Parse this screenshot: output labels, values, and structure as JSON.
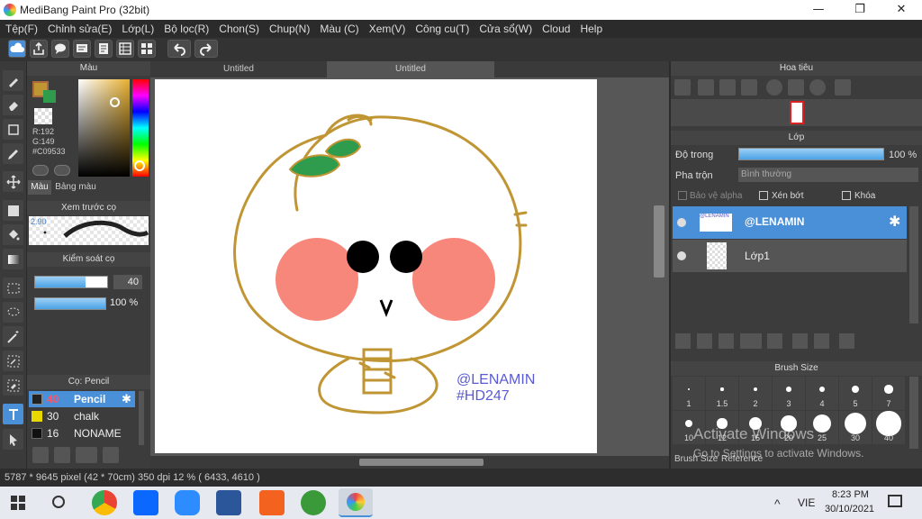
{
  "window": {
    "title": "MediBang Paint Pro (32bit)",
    "minimize": "—",
    "maximize": "❐",
    "close": "✕"
  },
  "menu": [
    "Tệp(F)",
    "Chỉnh sửa(E)",
    "Lớp(L)",
    "Bộ lọc(R)",
    "Chon(S)",
    "Chup(N)",
    "Màu (C)",
    "Xem(V)",
    "Công cu(T)",
    "Cửa sổ(W)",
    "Cloud",
    "Help"
  ],
  "toolbar_icons": [
    "cloud-icon",
    "share-icon",
    "comment-icon",
    "message-icon",
    "document-icon",
    "grid-icon",
    "layout-icon",
    "undo-icon",
    "redo-icon"
  ],
  "left_tools": [
    "brush-icon",
    "eraser-icon",
    "rectangle-icon",
    "pen-icon",
    "move-icon",
    "fill-rect-icon",
    "bucket-icon",
    "gradient-icon",
    "select-rect-icon",
    "lasso-icon",
    "magic-wand-icon",
    "select-pen-icon",
    "select-eraser-icon",
    "text-icon",
    "operation-icon"
  ],
  "color_panel": {
    "title": "Màu",
    "r": "R:192",
    "g": "G:149",
    "hex": "#C09533",
    "primary": "#C09533",
    "secondary": "#2e9c4c",
    "tab_color": "Màu",
    "tab_palette": "Bảng màu"
  },
  "brush_preview": {
    "title": "Xem trước cọ",
    "size": "2.90"
  },
  "brush_control": {
    "title": "Kiểm soát cọ",
    "size_value": "40",
    "opacity_value": "100 %",
    "size_fraction": 0.7,
    "opacity_fraction": 1.0
  },
  "brush_list": {
    "title": "Cọ: Pencil",
    "items": [
      {
        "size": "40",
        "name": "Pencil",
        "color": "#222222",
        "selected": true
      },
      {
        "size": "30",
        "name": "chalk",
        "color": "#e8d800",
        "selected": false
      },
      {
        "size": "16",
        "name": "NONAME",
        "color": "#111111",
        "selected": false
      }
    ]
  },
  "tabs": [
    "Untitled",
    "Untitled"
  ],
  "canvas_text": {
    "handle": "@LENAMIN",
    "tag": "#HD247"
  },
  "navigator": {
    "title": "Hoa tiêu"
  },
  "layer_panel": {
    "title": "Lớp",
    "opacity_label": "Độ trong",
    "opacity_value": "100 %",
    "opacity_fraction": 1.0,
    "blend_label": "Pha trộn",
    "blend_value": "Bình thường",
    "protect_alpha": "Bảo vệ alpha",
    "clip": "Xén bớt",
    "lock": "Khóa",
    "layers": [
      {
        "name": "@LENAMIN",
        "thumb_text": "@LENAMIN",
        "selected": true
      },
      {
        "name": "Lớp1",
        "thumb_text": "",
        "selected": false
      }
    ]
  },
  "brush_size_panel": {
    "title": "Brush Size",
    "row1": [
      "1",
      "1.5",
      "2",
      "3",
      "4",
      "5",
      "7"
    ],
    "row2": [
      "10",
      "12",
      "15",
      "20",
      "25",
      "30",
      "40"
    ],
    "tab1": "Brush Size",
    "tab2": "Reference"
  },
  "watermark": {
    "line1": "Activate Windows",
    "line2": "Go to Settings to activate Windows."
  },
  "status": {
    "text": "5787 * 9645 pixel   (42 * 70cm)   350 dpi   12 %   ( 6433, 4610 )"
  },
  "taskbar": {
    "lang": "VIE",
    "time": "8:23 PM",
    "date": "30/10/2021"
  },
  "colors": {
    "accent": "#4a90d9",
    "stroke": "#C09533",
    "leaf": "#2e9c4c",
    "cheek": "#f7877b"
  }
}
